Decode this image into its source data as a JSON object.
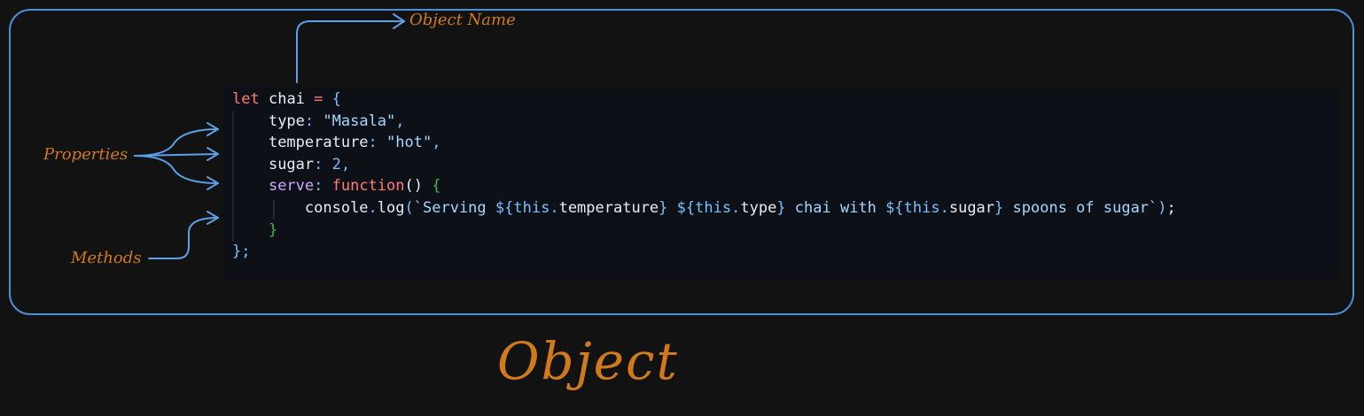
{
  "annotations": {
    "object_name": "Object Name",
    "properties": "Properties",
    "methods": "Methods",
    "caption": "Object"
  },
  "colors": {
    "frame_border": "#4a90d9",
    "arrow": "#5ba0e8",
    "annotation": "#d07a1c",
    "code_bg": "#0d1117",
    "page_bg": "#121212",
    "syntax": {
      "keyword": "#ff7b72",
      "identifier": "#e6edf3",
      "punctuation": "#79c0ff",
      "string": "#a5d6ff",
      "number": "#79c0ff",
      "method_key": "#d2a8ff",
      "function_keyword": "#ff7b72",
      "function_bracket": "#3fb950",
      "this_keyword": "#79c0ff"
    }
  },
  "code": {
    "lines": [
      [
        [
          "keyword",
          "let"
        ],
        [
          "plain",
          " "
        ],
        [
          "identifier",
          "chai"
        ],
        [
          "plain",
          " "
        ],
        [
          "keyword",
          "="
        ],
        [
          "plain",
          " "
        ],
        [
          "punctuation",
          "{"
        ]
      ],
      [
        [
          "plain",
          "    "
        ],
        [
          "identifier",
          "type"
        ],
        [
          "punctuation",
          ": "
        ],
        [
          "string",
          "\"Masala\""
        ],
        [
          "punctuation",
          ","
        ]
      ],
      [
        [
          "plain",
          "    "
        ],
        [
          "identifier",
          "temperature"
        ],
        [
          "punctuation",
          ": "
        ],
        [
          "string",
          "\"hot\""
        ],
        [
          "punctuation",
          ","
        ]
      ],
      [
        [
          "plain",
          "    "
        ],
        [
          "identifier",
          "sugar"
        ],
        [
          "punctuation",
          ": "
        ],
        [
          "number",
          "2"
        ],
        [
          "punctuation",
          ","
        ]
      ],
      [
        [
          "plain",
          "    "
        ],
        [
          "method_key",
          "serve"
        ],
        [
          "punctuation",
          ": "
        ],
        [
          "function_keyword",
          "function"
        ],
        [
          "identifier",
          "()"
        ],
        [
          "plain",
          " "
        ],
        [
          "function_bracket",
          "{"
        ]
      ],
      [
        [
          "plain",
          "        "
        ],
        [
          "identifier",
          "console"
        ],
        [
          "punctuation",
          "."
        ],
        [
          "identifier",
          "log"
        ],
        [
          "punctuation",
          "("
        ],
        [
          "string",
          "`Serving "
        ],
        [
          "punctuation",
          "${"
        ],
        [
          "this_keyword",
          "this"
        ],
        [
          "punctuation",
          "."
        ],
        [
          "identifier",
          "temperature"
        ],
        [
          "punctuation",
          "}"
        ],
        [
          "string",
          " "
        ],
        [
          "punctuation",
          "${"
        ],
        [
          "this_keyword",
          "this"
        ],
        [
          "punctuation",
          "."
        ],
        [
          "identifier",
          "type"
        ],
        [
          "punctuation",
          "}"
        ],
        [
          "string",
          " chai with "
        ],
        [
          "punctuation",
          "${"
        ],
        [
          "this_keyword",
          "this"
        ],
        [
          "punctuation",
          "."
        ],
        [
          "identifier",
          "sugar"
        ],
        [
          "punctuation",
          "}"
        ],
        [
          "string",
          " spoons of sugar`"
        ],
        [
          "punctuation",
          ")"
        ],
        [
          "identifier",
          ";"
        ]
      ],
      [
        [
          "plain",
          "    "
        ],
        [
          "function_bracket",
          "}"
        ]
      ],
      [
        [
          "punctuation",
          "};"
        ]
      ]
    ]
  }
}
